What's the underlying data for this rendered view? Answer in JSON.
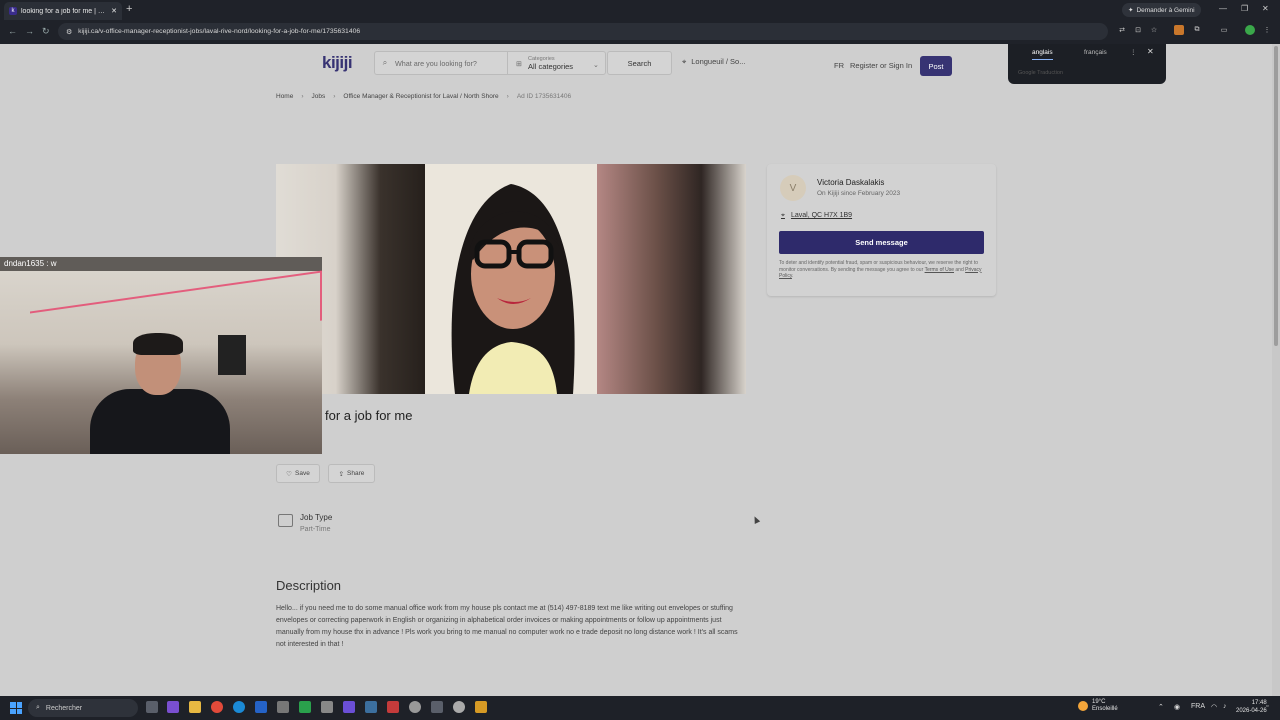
{
  "browser": {
    "tab_title": "looking for a job for me | Office",
    "tab_favicon": "k",
    "new_tab": "+",
    "gemini": "Demander à Gemini",
    "url": "kijiji.ca/v-office-manager-receptionist-jobs/laval-rive-nord/looking-for-a-job-for-me/1735631406"
  },
  "translate": {
    "lang1": "anglais",
    "lang2": "français",
    "brand": "Google Traduction"
  },
  "header": {
    "logo": "kijiji",
    "search_placeholder": "What are you looking for?",
    "category_label": "Categories",
    "category_value": "All categories",
    "search_button": "Search",
    "location": "Longueuil / So...",
    "lang": "FR",
    "register": "Register or Sign In",
    "post": "Post"
  },
  "breadcrumb": {
    "home": "Home",
    "jobs": "Jobs",
    "category": "Office Manager & Receptionist for Laval / North Shore",
    "ad_id": "Ad ID 1735631406"
  },
  "seller": {
    "initial": "V",
    "name": "Victoria Daskalakis",
    "since": "On Kijiji since February 2023",
    "location": "Laval, QC H7X 1B9",
    "send_button": "Send message",
    "disclaimer": "To deter and identify potential fraud, spam or suspicious behaviour, we reserve the right to monitor conversations. By sending the message you agree to our",
    "terms": "Terms of Use",
    "and": "and",
    "privacy": "Privacy Policy",
    "period": "."
  },
  "ad": {
    "title_visible": "for a job for me",
    "save": "Save",
    "share": "Share",
    "job_type_label": "Job Type",
    "job_type_value": "Part-Time",
    "description_heading": "Description",
    "description": "Hello... if you need me to do some manual office work from my house pls contact me at (514) 497-8189 text me like writing out envelopes or stuffing envelopes or correcting paperwork in English or organizing in alphabetical order invoices or making appointments or follow up appointments just manually from my house thx in advance ! Pls work you bring to me manual no computer work no e trade deposit no long distance work ! It's all scams not interested in that !"
  },
  "stream": {
    "chat_user": "dndan1635 : w"
  },
  "taskbar": {
    "search": "Rechercher",
    "weather_temp": "19°C",
    "weather_desc": "Ensoleillé",
    "lang": "FRA",
    "time": "17:48",
    "date": "2026-04-26"
  },
  "colors": {
    "brand": "#373373",
    "send_button": "#2e2a6b"
  }
}
